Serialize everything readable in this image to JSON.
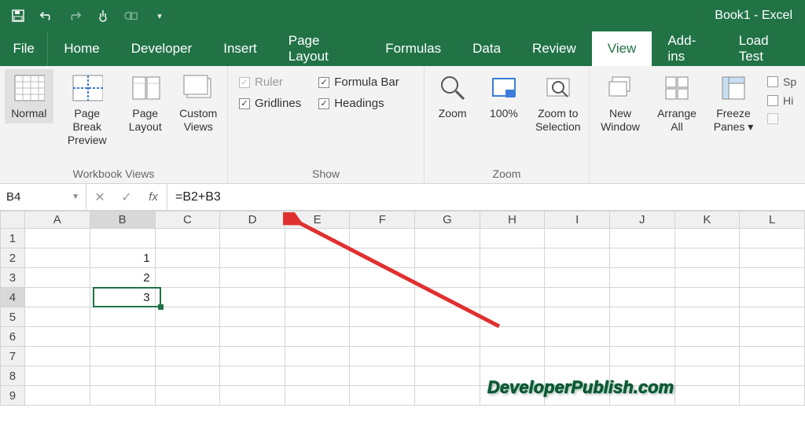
{
  "title": "Book1 - Excel",
  "tabs": {
    "file": "File",
    "items": [
      "Home",
      "Developer",
      "Insert",
      "Page Layout",
      "Formulas",
      "Data",
      "Review",
      "View",
      "Add-ins",
      "Load Test"
    ],
    "active": "View"
  },
  "ribbon": {
    "workbook_views": {
      "label": "Workbook Views",
      "normal": "Normal",
      "page_break": "Page Break Preview",
      "page_layout": "Page Layout",
      "custom": "Custom Views"
    },
    "show": {
      "label": "Show",
      "ruler": "Ruler",
      "gridlines": "Gridlines",
      "formula_bar": "Formula Bar",
      "headings": "Headings"
    },
    "zoom": {
      "label": "Zoom",
      "zoom": "Zoom",
      "hundred": "100%",
      "selection": "Zoom to Selection"
    },
    "window": {
      "new_window": "New Window",
      "arrange": "Arrange All",
      "freeze": "Freeze Panes ▾",
      "split": "Sp",
      "hide": "Hi"
    }
  },
  "name_box": "B4",
  "formula": "=B2+B3",
  "columns": [
    "A",
    "B",
    "C",
    "D",
    "E",
    "F",
    "G",
    "H",
    "I",
    "J",
    "K",
    "L"
  ],
  "rows": [
    "1",
    "2",
    "3",
    "4",
    "5",
    "6",
    "7",
    "8",
    "9"
  ],
  "cells": {
    "B2": "1",
    "B3": "2",
    "B4": "3"
  },
  "active_cell": "B4",
  "watermark": "DeveloperPublish.com"
}
